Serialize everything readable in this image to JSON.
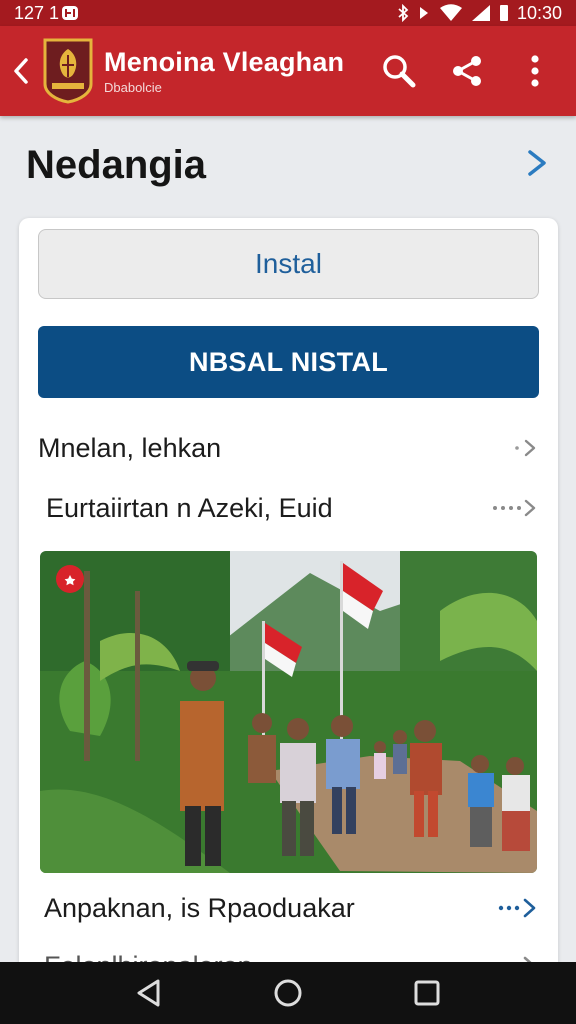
{
  "status": {
    "left_text": "127 1",
    "time": "10:30"
  },
  "app_bar": {
    "title": "Menoina Vleaghan",
    "subtitle": "Dbabolcie",
    "colors": {
      "bar": "#c4262b",
      "status": "#a41a1f"
    },
    "icons": [
      "back-arrow-icon",
      "search-icon",
      "share-icon",
      "more-vert-icon"
    ]
  },
  "page": {
    "title": "Nedangia"
  },
  "card": {
    "secondary_button": "Instal",
    "primary_button": "NBSAL NISTAL",
    "items": [
      {
        "label": "Mnelan, lehkan"
      },
      {
        "label": "Eurtaiirtan n Azeki, Euid"
      }
    ],
    "photo_caption": {
      "label": "Anpaknan, is Rpaoduakar"
    },
    "partial_item": {
      "label": "Felonlhirenaleren"
    }
  },
  "nav": {
    "icons": [
      "back-triangle-icon",
      "home-circle-icon",
      "recents-square-icon"
    ]
  }
}
